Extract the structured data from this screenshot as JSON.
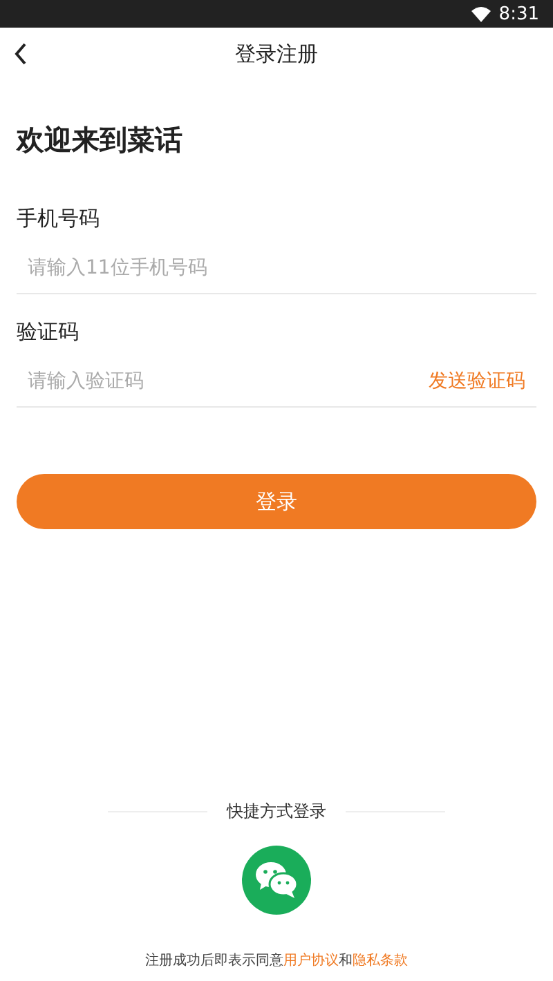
{
  "status_bar": {
    "time": "8:31"
  },
  "nav": {
    "title": "登录注册"
  },
  "heading": "欢迎来到菜话",
  "fields": [
    {
      "label": "手机号码",
      "placeholder": "请输入11位手机号码"
    },
    {
      "label": "验证码",
      "placeholder": "请输入验证码",
      "action": "发送验证码"
    }
  ],
  "login_button": "登录",
  "quick_login": {
    "title": "快捷方式登录",
    "options": [
      {
        "kind": "wechat"
      }
    ]
  },
  "footer": [
    {
      "kind": "plain",
      "text": "注册成功后即表示同意"
    },
    {
      "kind": "link",
      "text": "用户协议"
    },
    {
      "kind": "plain",
      "text": "和"
    },
    {
      "kind": "link",
      "text": "隐私条款"
    }
  ]
}
